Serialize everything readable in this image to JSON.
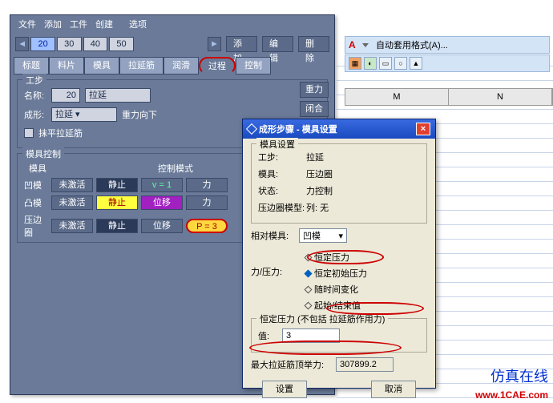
{
  "menu": {
    "file": "文件",
    "add": "添加",
    "work": "工件",
    "create": "创建",
    "option": "选项"
  },
  "ruler": {
    "prev": "◄",
    "values": [
      "20",
      "30",
      "40",
      "50"
    ],
    "next": "►",
    "add": "添加",
    "edit": "编辑",
    "delete": "删除"
  },
  "tabs": [
    "标题",
    "料片",
    "模具",
    "拉延筋",
    "润滑",
    "过程",
    "控制"
  ],
  "auto": {
    "label": "自动套用格式(A)..."
  },
  "spreadsheet": {
    "cols": [
      "M",
      "N"
    ]
  },
  "group_step": {
    "title": "工步",
    "name_label": "名称:",
    "name_idx": "20",
    "name_val": "拉延",
    "form_label": "成形:",
    "form_val": "拉延",
    "grav": "重力向下",
    "flatten": "抹平拉延筋",
    "side": {
      "grav": "重力",
      "close": "闭合"
    }
  },
  "group_tool": {
    "title": "模具控制",
    "col_tool": "模具",
    "col_mode": "控制模式",
    "rows": [
      {
        "lab": "凹模",
        "c1": "未激活",
        "c2": "静止",
        "c3": "v = 1",
        "c4": "力"
      },
      {
        "lab": "凸模",
        "c1": "未激活",
        "c2": "静止",
        "c3": "位移",
        "c4": "力"
      },
      {
        "lab": "压边圈",
        "c1": "未激活",
        "c2": "静止",
        "c3": "位移",
        "c4": "P = 3"
      }
    ]
  },
  "dlg": {
    "title": "成形步骤 - 模具设置",
    "set": {
      "title": "模具设置",
      "step_l": "工步:",
      "step_v": "拉延",
      "tool_l": "模具:",
      "tool_v": "压边圈",
      "status_l": "状态:",
      "status_v": "力控制",
      "ring_l": "压边圈模型:",
      "ring_v": "列: 无"
    },
    "rel_l": "相对模具:",
    "rel_v": "凹模",
    "fp": {
      "label": "力/压力:",
      "opt1": "恒定压力",
      "opt2": "恒定初始压力",
      "opt3": "随时间变化",
      "opt4": "起始/结束值"
    },
    "const": {
      "title": "恒定压力 (",
      "ex": "不包括",
      "tail": " 拉延筋作用力)",
      "val_l": "值:",
      "val": "3"
    },
    "max": {
      "label": "最大拉延筋顶举力:",
      "value": "307899.2"
    },
    "ok": "设置",
    "cancel": "取消"
  },
  "brand": {
    "name": "仿真在线",
    "url": "www.1CAE.com"
  }
}
